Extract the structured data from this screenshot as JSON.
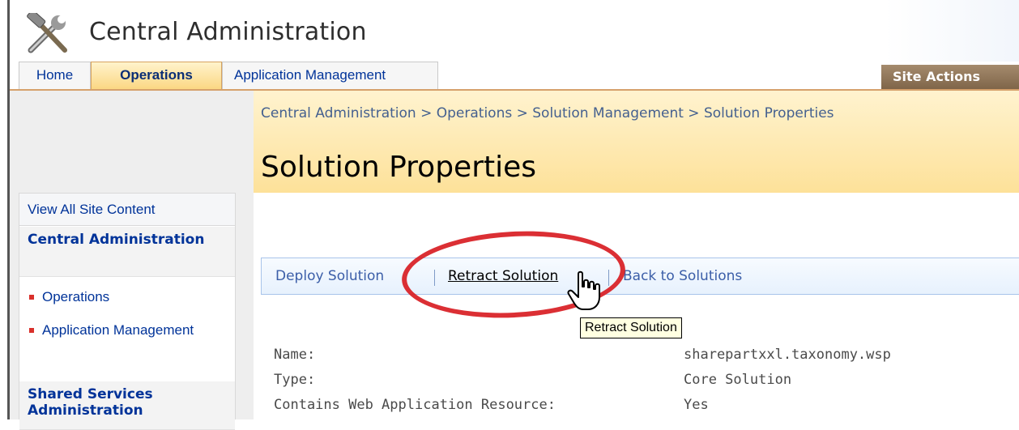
{
  "header": {
    "site_title": "Central Administration"
  },
  "tabs": [
    {
      "label": "Home"
    },
    {
      "label": "Operations",
      "selected": true
    },
    {
      "label": "Application Management"
    }
  ],
  "site_actions": {
    "label": "Site Actions"
  },
  "nav": {
    "view_all": "View All Site Content",
    "central_admin_heading": "Central Administration",
    "items": [
      "Operations",
      "Application Management"
    ],
    "shared_services_heading": "Shared Services Administration"
  },
  "breadcrumb": "Central Administration > Operations > Solution Management > Solution Properties",
  "page_title": "Solution Properties",
  "toolbar": {
    "deploy": "Deploy Solution",
    "retract": "Retract Solution",
    "back": "Back to Solutions",
    "separator": "|"
  },
  "tooltip": "Retract Solution",
  "properties": [
    {
      "label": "Name:",
      "value": "sharepartxxl.taxonomy.wsp"
    },
    {
      "label": "Type:",
      "value": "Core Solution"
    },
    {
      "label": "Contains Web Application Resource:",
      "value": "Yes"
    }
  ],
  "colors": {
    "link": "#003399",
    "header_band": "#fde199",
    "highlight_circle": "#d81d23",
    "tab_selected": "#fbd783"
  },
  "icons": {
    "title_icon": "tools-icon",
    "cursor": "hand-cursor-icon"
  }
}
